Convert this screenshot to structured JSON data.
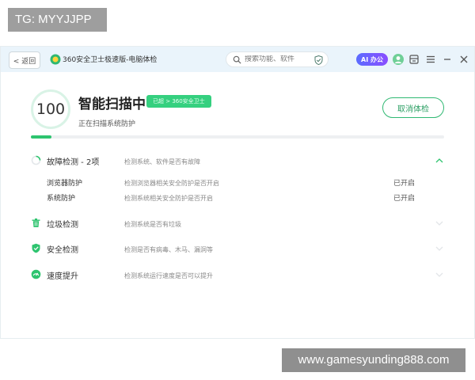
{
  "overlay": {
    "top_left": "TG: MYYJJPP",
    "bottom_right": "www.gamesyunding888.com"
  },
  "titlebar": {
    "back_label": "< 返回",
    "app_title": "360安全卫士极速版-电脑体检",
    "search_placeholder": "搜索功能、软件",
    "ai_label": "AI 办公"
  },
  "scan": {
    "score": "100",
    "title": "智能扫描中",
    "badge": "已超 > 360安全卫士",
    "subtitle": "正在扫描系统防护",
    "cancel_label": "取消体检",
    "progress": 0.05
  },
  "sections": [
    {
      "title": "故障检测 - 2项",
      "desc": "检测系统、软件是否有故障",
      "icon": "spinner-icon",
      "expanded": true,
      "items": [
        {
          "name": "浏览器防护",
          "desc": "检测浏览器相关安全防护是否开启",
          "status": "已开启"
        },
        {
          "name": "系统防护",
          "desc": "检测系统相关安全防护是否开启",
          "status": "已开启"
        }
      ]
    },
    {
      "title": "垃圾检测",
      "desc": "检测系统是否有垃圾",
      "icon": "trash-icon",
      "expanded": false,
      "items": []
    },
    {
      "title": "安全检测",
      "desc": "检测是否有病毒、木马、漏洞等",
      "icon": "shield-icon",
      "expanded": false,
      "items": []
    },
    {
      "title": "速度提升",
      "desc": "检测系统运行速度是否可以提升",
      "icon": "speedometer-icon",
      "expanded": false,
      "items": []
    }
  ],
  "colors": {
    "accent": "#2ec46f",
    "titlebar": "#eaf4fb"
  }
}
